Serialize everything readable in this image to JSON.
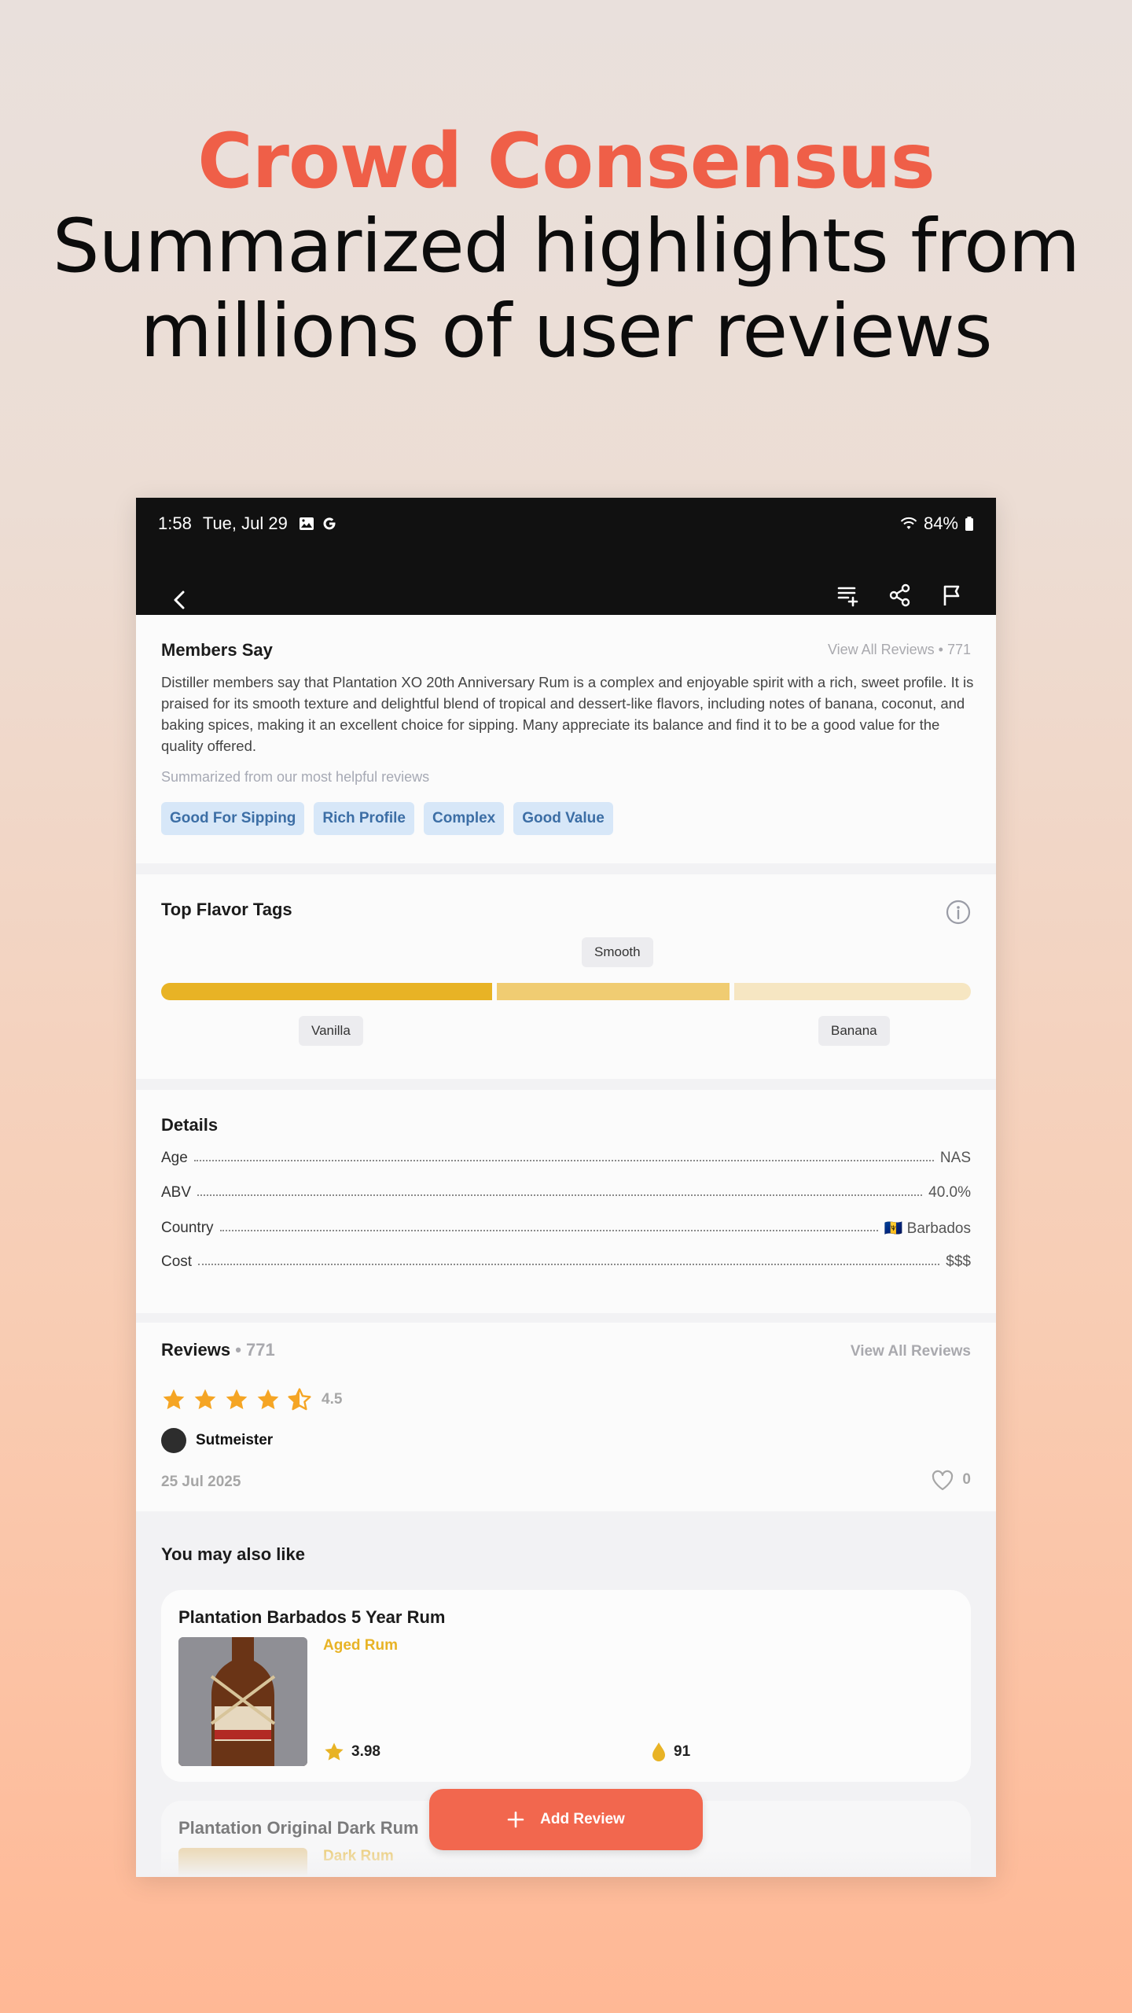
{
  "hero": {
    "title": "Crowd Consensus",
    "line1": "Summarized highlights from",
    "line2": "millions of user reviews"
  },
  "status": {
    "time": "1:58",
    "date": "Tue, Jul 29",
    "battery": "84%"
  },
  "icons": {
    "back": "chevron-left-icon",
    "add_to_list": "playlist-add-icon",
    "share": "share-icon",
    "report": "flag-icon"
  },
  "members": {
    "title": "Members Say",
    "view_all": "View All Reviews • 771",
    "summary": "Distiller members say that Plantation XO 20th Anniversary Rum is a complex and enjoyable spirit with a rich, sweet profile. It is praised for its smooth texture and delightful blend of tropical and dessert-like flavors, including notes of banana, coconut, and baking spices, making it an excellent choice for sipping. Many appreciate its balance and find it to be a good value for the quality offered.",
    "note": "Summarized from our most helpful reviews",
    "tags": [
      "Good For Sipping",
      "Rich Profile",
      "Complex",
      "Good Value"
    ]
  },
  "flavor": {
    "title": "Top Flavor Tags",
    "tags": [
      {
        "label": "Vanilla",
        "share": 0.414
      },
      {
        "label": "Smooth",
        "share": 0.29
      },
      {
        "label": "Banana",
        "share": 0.296
      }
    ],
    "colors": [
      "#e8b325",
      "#f0cc72",
      "#f6e6c2"
    ]
  },
  "details": {
    "title": "Details",
    "rows": [
      {
        "label": "Age",
        "value": "NAS"
      },
      {
        "label": "ABV",
        "value": "40.0%"
      },
      {
        "label": "Country",
        "value": "🇧🇧 Barbados"
      },
      {
        "label": "Cost",
        "value": "$$$"
      }
    ]
  },
  "reviews": {
    "title": "Reviews",
    "count": "• 771",
    "view_all": "View All Reviews",
    "rating": "4.5",
    "user": "Sutmeister",
    "date": "25 Jul 2025",
    "likes": "0"
  },
  "also": {
    "title": "You may also like",
    "items": [
      {
        "name": "Plantation Barbados 5 Year Rum",
        "type": "Aged Rum",
        "score": "3.98",
        "drops": "91"
      },
      {
        "name": "Plantation Original Dark Rum",
        "type": "Dark Rum"
      }
    ]
  },
  "fab": {
    "label": "Add Review"
  }
}
